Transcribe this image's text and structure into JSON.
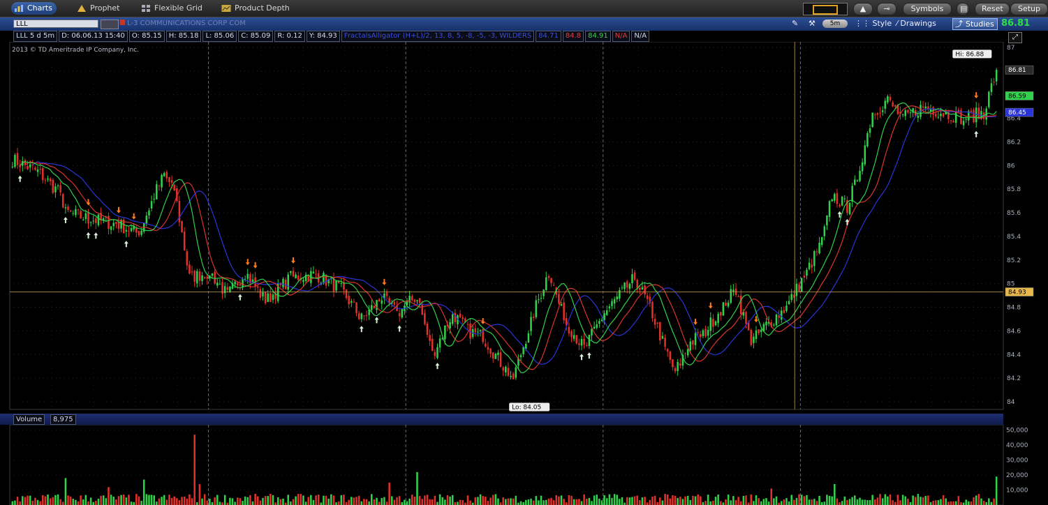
{
  "tabs": [
    {
      "label": "Charts",
      "icon": "chart-icon",
      "active": true
    },
    {
      "label": "Prophet",
      "icon": "prophet-icon",
      "active": false
    },
    {
      "label": "Flexible Grid",
      "icon": "grid-icon",
      "active": false
    },
    {
      "label": "Product Depth",
      "icon": "depth-icon",
      "active": false
    }
  ],
  "top_buttons": {
    "symbols": "Symbols",
    "reset": "Reset",
    "setup": "Setup"
  },
  "header": {
    "symbol": "LLL",
    "company": "L-3 COMMUNICATIONS CORP COM",
    "period": "5m",
    "style": "Style",
    "drawings": "Drawings",
    "studies": "Studies",
    "last_price": "86.81"
  },
  "info": {
    "symbol_period": "LLL 5 d 5m",
    "date": "D: 06.06.13 15:40",
    "open": "O: 85.15",
    "high": "H: 85.18",
    "low": "L: 85.06",
    "close": "C: 85.09",
    "range": "R: 0.12",
    "y": "Y: 84.93",
    "study": "FractalsAlligator (H+L)/2, 13, 8, 5, -8, -5, -3, WILDERS",
    "study_v1": "84.71",
    "study_v2": "84.8",
    "study_v3": "84.91",
    "na1": "N/A",
    "na2": "N/A"
  },
  "copyright": "2013 © TD Ameritrade IP Company, Inc.",
  "volume_pane": {
    "label": "Volume",
    "value": "8,975"
  },
  "colors": {
    "up": "#31d14b",
    "down": "#e0322a",
    "jaw": "#2b34d8",
    "teeth": "#d8352f",
    "lips": "#2fd14a",
    "fractal_up": "#ff7a1c",
    "fractal_down": "#d8f0d8",
    "crosshair": "#c8a24e"
  },
  "chart_data": {
    "type": "candlestick",
    "title": "LLL 5 d 5m",
    "ylabel": "",
    "ylim": [
      84.0,
      87.0
    ],
    "y_ticks": [
      "87",
      "86.8",
      "86.6",
      "86.4",
      "86.2",
      "86",
      "85.8",
      "85.6",
      "85.4",
      "85.2",
      "85",
      "84.8",
      "84.6",
      "84.4",
      "84.2",
      "84"
    ],
    "y_tick_values": [
      87,
      86.8,
      86.6,
      86.4,
      86.2,
      86,
      85.8,
      85.6,
      85.4,
      85.2,
      85,
      84.8,
      84.6,
      84.4,
      84.2,
      84
    ],
    "price_badges": [
      {
        "label": "86.81",
        "value": 86.81,
        "color": "#ffffff",
        "bg": "#2a2a2a"
      },
      {
        "label": "86.59",
        "value": 86.59,
        "color": "#000000",
        "bg": "#31d14b"
      },
      {
        "label": "86.45",
        "value": 86.45,
        "color": "#ffffff",
        "bg": "#2b34d8"
      },
      {
        "label": "84.93",
        "value": 84.93,
        "color": "#000000",
        "bg": "#e8b84a"
      }
    ],
    "high_label": {
      "text": "Hi: 86.88",
      "value": 86.88
    },
    "low_label": {
      "text": "Lo: 84.05",
      "value": 84.05
    },
    "bar_count": 390,
    "day_separators_bar": [
      78,
      156,
      234,
      312
    ],
    "close_anchors": [
      [
        0,
        86.05
      ],
      [
        10,
        85.95
      ],
      [
        18,
        85.78
      ],
      [
        22,
        85.6
      ],
      [
        30,
        85.55
      ],
      [
        42,
        85.5
      ],
      [
        50,
        85.42
      ],
      [
        56,
        85.75
      ],
      [
        60,
        85.92
      ],
      [
        64,
        85.8
      ],
      [
        70,
        85.05
      ],
      [
        78,
        85.1
      ],
      [
        85,
        84.9
      ],
      [
        92,
        85.1
      ],
      [
        100,
        84.85
      ],
      [
        110,
        85.05
      ],
      [
        120,
        85.08
      ],
      [
        130,
        84.95
      ],
      [
        138,
        84.7
      ],
      [
        146,
        84.88
      ],
      [
        152,
        84.75
      ],
      [
        160,
        84.9
      ],
      [
        166,
        84.4
      ],
      [
        174,
        84.75
      ],
      [
        180,
        84.6
      ],
      [
        186,
        84.55
      ],
      [
        194,
        84.3
      ],
      [
        198,
        84.2
      ],
      [
        206,
        84.75
      ],
      [
        212,
        85.1
      ],
      [
        218,
        84.7
      ],
      [
        226,
        84.45
      ],
      [
        234,
        84.75
      ],
      [
        240,
        84.9
      ],
      [
        246,
        85.05
      ],
      [
        252,
        84.8
      ],
      [
        258,
        84.45
      ],
      [
        262,
        84.25
      ],
      [
        268,
        84.5
      ],
      [
        274,
        84.6
      ],
      [
        282,
        84.85
      ],
      [
        286,
        84.95
      ],
      [
        292,
        84.5
      ],
      [
        298,
        84.65
      ],
      [
        306,
        84.8
      ],
      [
        314,
        85.1
      ],
      [
        320,
        85.35
      ],
      [
        324,
        85.75
      ],
      [
        330,
        85.65
      ],
      [
        334,
        85.9
      ],
      [
        340,
        86.45
      ],
      [
        346,
        86.55
      ],
      [
        352,
        86.4
      ],
      [
        360,
        86.5
      ],
      [
        368,
        86.45
      ],
      [
        376,
        86.4
      ],
      [
        384,
        86.45
      ],
      [
        389,
        86.81
      ]
    ],
    "volume": {
      "ylim": [
        0,
        55000
      ],
      "y_ticks": [
        "50,000",
        "40,000",
        "30,000",
        "20,000",
        "10,000"
      ],
      "y_tick_values": [
        50000,
        40000,
        30000,
        20000,
        10000
      ],
      "spikes": [
        [
          21,
          18000
        ],
        [
          38,
          12000
        ],
        [
          52,
          17000
        ],
        [
          72,
          47000
        ],
        [
          74,
          14000
        ],
        [
          149,
          15000
        ],
        [
          160,
          22000
        ],
        [
          300,
          11000
        ],
        [
          325,
          14000
        ],
        [
          389,
          19000
        ]
      ]
    }
  }
}
